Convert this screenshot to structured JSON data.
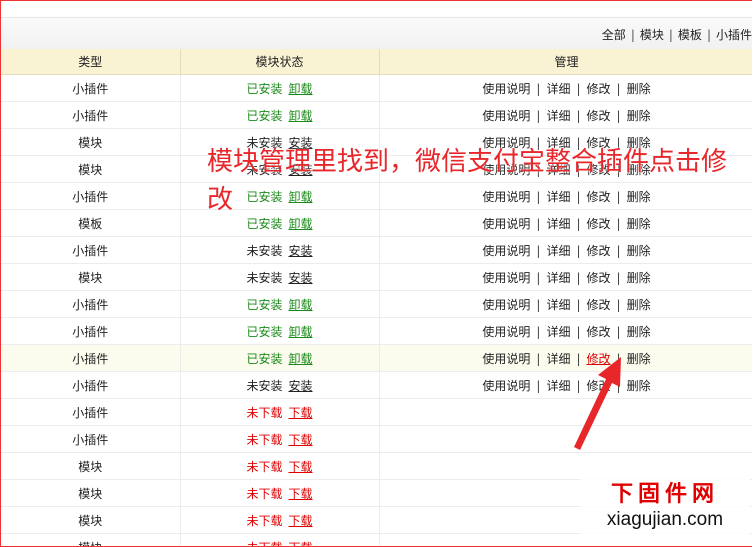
{
  "filters": [
    "全部",
    "模块",
    "模板",
    "小插件"
  ],
  "table": {
    "headers": [
      "类型",
      "模块状态",
      "管理"
    ],
    "ops": [
      "使用说明",
      "详细",
      "修改",
      "删除"
    ],
    "rows": [
      {
        "type": "小插件",
        "status": "已安装",
        "action": "卸载",
        "kind": "ok",
        "ops": true
      },
      {
        "type": "小插件",
        "status": "已安装",
        "action": "卸载",
        "kind": "ok",
        "ops": true
      },
      {
        "type": "模块",
        "status": "未安装",
        "action": "安装",
        "kind": "no",
        "ops": true
      },
      {
        "type": "模块",
        "status": "未安装",
        "action": "安装",
        "kind": "no",
        "ops": true
      },
      {
        "type": "小插件",
        "status": "已安装",
        "action": "卸载",
        "kind": "ok",
        "ops": true
      },
      {
        "type": "模板",
        "status": "已安装",
        "action": "卸载",
        "kind": "ok",
        "ops": true
      },
      {
        "type": "小插件",
        "status": "未安装",
        "action": "安装",
        "kind": "no",
        "ops": true
      },
      {
        "type": "模块",
        "status": "未安装",
        "action": "安装",
        "kind": "no",
        "ops": true
      },
      {
        "type": "小插件",
        "status": "已安装",
        "action": "卸载",
        "kind": "ok",
        "ops": true
      },
      {
        "type": "小插件",
        "status": "已安装",
        "action": "卸载",
        "kind": "ok",
        "ops": true
      },
      {
        "type": "小插件",
        "status": "已安装",
        "action": "卸载",
        "kind": "ok",
        "ops": true,
        "highlight": true
      },
      {
        "type": "小插件",
        "status": "未安装",
        "action": "安装",
        "kind": "no",
        "ops": true
      },
      {
        "type": "小插件",
        "status": "未下载",
        "action": "下载",
        "kind": "dl",
        "ops": false
      },
      {
        "type": "小插件",
        "status": "未下载",
        "action": "下载",
        "kind": "dl",
        "ops": false
      },
      {
        "type": "模块",
        "status": "未下载",
        "action": "下载",
        "kind": "dl",
        "ops": false
      },
      {
        "type": "模块",
        "status": "未下载",
        "action": "下载",
        "kind": "dl",
        "ops": false
      },
      {
        "type": "模块",
        "status": "未下载",
        "action": "下载",
        "kind": "dl",
        "ops": false
      },
      {
        "type": "模块",
        "status": "未下载",
        "action": "下载",
        "kind": "dl",
        "ops": false
      }
    ]
  },
  "annotation": {
    "text": "模块管理里找到，微信支付宝整合插件点击修改",
    "color": "#e8272b"
  },
  "watermark": {
    "cn": "下固件网",
    "en": "xiagujian.com"
  },
  "colors": {
    "installed": "#1a8a1a",
    "download": "#e00000",
    "header_bg": "#f9f3d3",
    "frame": "#ee3333"
  }
}
